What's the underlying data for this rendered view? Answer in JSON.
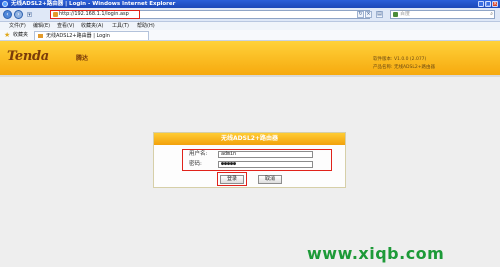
{
  "window": {
    "title": "无线ADSL2+路由器 | Login - Windows Internet Explorer",
    "controls": [
      "_",
      "□",
      "×"
    ]
  },
  "address_bar": {
    "url": "http://192.168.1.1/login.asp",
    "search_placeholder": "百度",
    "icons": [
      "back-icon",
      "forward-icon",
      "refresh-icon",
      "stop-icon",
      "search-icon"
    ]
  },
  "menu": [
    "文件(F)",
    "编辑(E)",
    "查看(V)",
    "收藏夹(A)",
    "工具(T)",
    "帮助(H)"
  ],
  "favorites": {
    "label": "收藏夹"
  },
  "tab": {
    "label": "无线ADSL2+路由器 | Login"
  },
  "banner": {
    "logo": "Tenda",
    "logo_cn": "腾达",
    "fw_version": "软件版本: V1.0.0 (2.077)",
    "product_name": "产品名称: 无线ADSL2+路由器",
    "brand_color": "#f6a90e"
  },
  "login": {
    "title": "无线ADSL2+路由器",
    "username_label": "用户名:",
    "username_value": "admin",
    "password_label": "密码:",
    "password_value": "●●●●●",
    "login_button": "登录",
    "cancel_button": "取消"
  },
  "watermark": "www.xiqb.com",
  "colors": {
    "highlight": "#e0231b",
    "watermark": "#1d9a38"
  }
}
